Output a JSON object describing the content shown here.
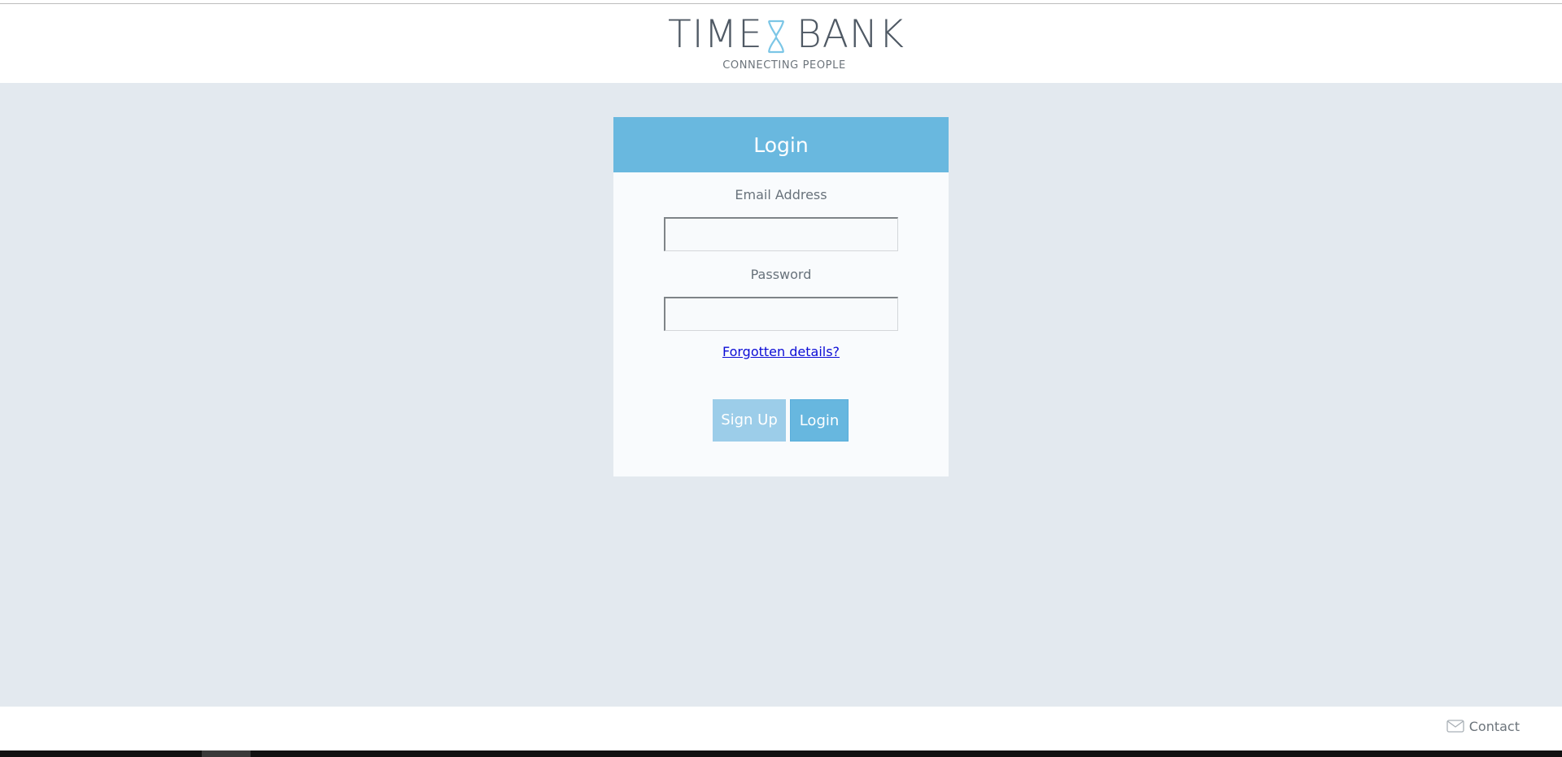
{
  "brand": {
    "word_left": "TIME",
    "word_right": "BANK",
    "tagline": "CONNECTING PEOPLE",
    "icon": "hourglass-icon",
    "icon_color": "#7cc6e6"
  },
  "login_card": {
    "title": "Login",
    "email_label": "Email Address",
    "email_value": "",
    "password_label": "Password",
    "password_value": "",
    "forgot_link": "Forgotten details?",
    "signup_button": "Sign Up",
    "login_button": "Login"
  },
  "footer": {
    "contact_label": "Contact",
    "contact_icon": "mail-icon"
  },
  "colors": {
    "accent": "#69b8df",
    "accent_light": "#9ccde9",
    "page_background": "#e3e9ef",
    "link": "#0c0cd6"
  }
}
